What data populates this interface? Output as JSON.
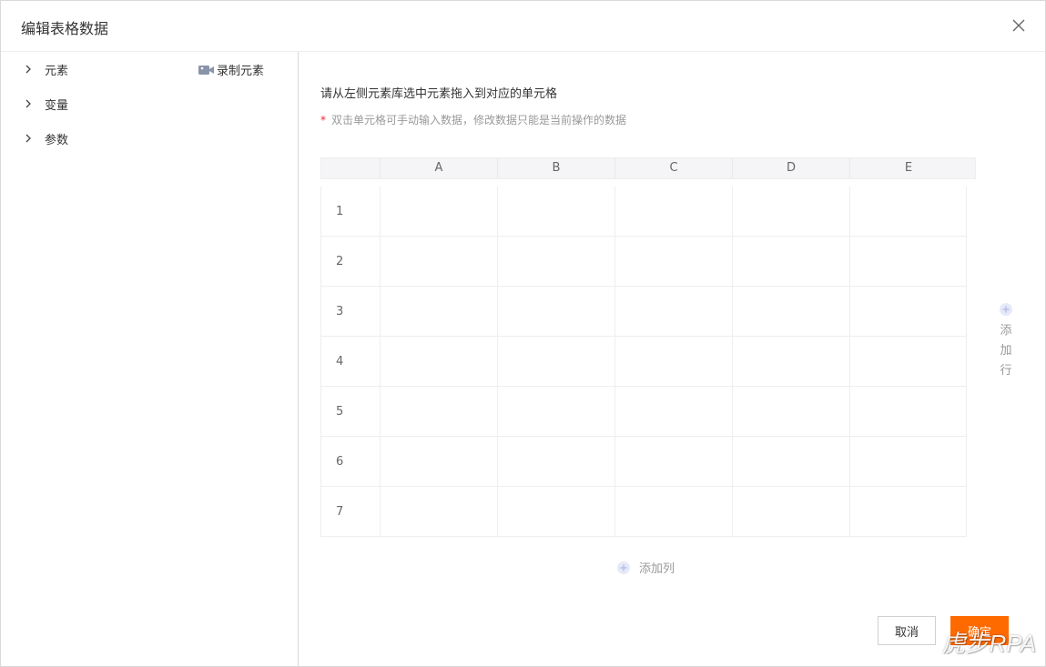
{
  "dialog": {
    "title": "编辑表格数据",
    "close_icon": "close-icon"
  },
  "sidebar": {
    "items": [
      {
        "label": "元素",
        "icon": "chevron-right-icon"
      },
      {
        "label": "变量",
        "icon": "chevron-right-icon"
      },
      {
        "label": "参数",
        "icon": "chevron-right-icon"
      }
    ],
    "record": {
      "label": "录制元素",
      "icon": "camera-icon"
    }
  },
  "main": {
    "instruction": "请从左侧元素库选中元素拖入到对应的单元格",
    "hint_star": "*",
    "hint": "双击单元格可手动输入数据，修改数据只能是当前操作的数据"
  },
  "grid": {
    "columns": [
      "A",
      "B",
      "C",
      "D",
      "E"
    ],
    "rows": [
      "1",
      "2",
      "3",
      "4",
      "5",
      "6",
      "7"
    ],
    "cells": [
      [
        "",
        "",
        "",
        "",
        ""
      ],
      [
        "",
        "",
        "",
        "",
        ""
      ],
      [
        "",
        "",
        "",
        "",
        ""
      ],
      [
        "",
        "",
        "",
        "",
        ""
      ],
      [
        "",
        "",
        "",
        "",
        ""
      ],
      [
        "",
        "",
        "",
        "",
        ""
      ],
      [
        "",
        "",
        "",
        "",
        ""
      ]
    ]
  },
  "actions": {
    "add_row": "添加行",
    "add_col": "添加列",
    "cancel": "取消",
    "ok": "确定"
  },
  "watermark": "虎步RPA",
  "colors": {
    "accent": "#ff6a00",
    "required": "#f5222d",
    "muted": "#999999",
    "icon_light": "#c8cdf0"
  }
}
